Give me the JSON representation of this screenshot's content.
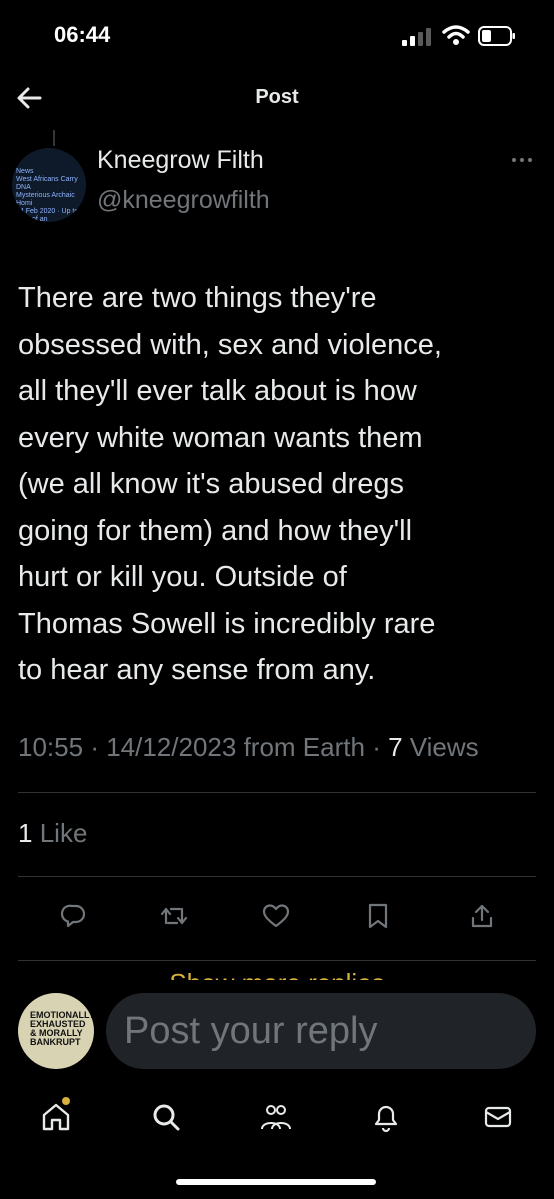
{
  "status_bar": {
    "time": "06:44"
  },
  "header": {
    "title": "Post"
  },
  "author": {
    "display_name": "Kneegrow Filth",
    "handle": "@kneegrowfilth",
    "avatar_text": "News\nWest Africans Carry DNA\nMysterious Archaic Homi\n14 Feb 2020 · Up to 19% of an\nunknown non-homo sapien ancestr\nis missing the 3-4 ... Africa bred\nsome kind of furry primitive\nfeature"
  },
  "post": {
    "text": "There are two things they're\nobsessed with, sex and violence,\nall they'll ever talk about is how\nevery white woman wants them\n(we all know it's abused dregs\ngoing for them) and how they'll\nhurt or kill you. Outside of\nThomas Sowell is incredibly rare\nto hear any sense from any.",
    "time": "10:55",
    "date": "14/12/2023",
    "source": "from Earth",
    "views_count": "7",
    "views_label": "Views",
    "likes_count": "1",
    "likes_label": "Like"
  },
  "actions": {
    "icons": [
      "reply-icon",
      "repost-icon",
      "like-icon",
      "bookmark-icon",
      "share-icon"
    ]
  },
  "show_more": "Show more replies",
  "reply": {
    "placeholder": "Post your reply",
    "avatar_text": "EMOTIONALLY\nEXHAUSTED\n& MORALLY\nBANKRUPT"
  },
  "nav": {
    "icons": [
      "home-icon",
      "search-icon",
      "communities-icon",
      "notifications-icon",
      "messages-icon"
    ]
  },
  "colors": {
    "background": "#000000",
    "text": "#e7e9ea",
    "muted": "#71767b",
    "accent": "#d9b13d"
  }
}
